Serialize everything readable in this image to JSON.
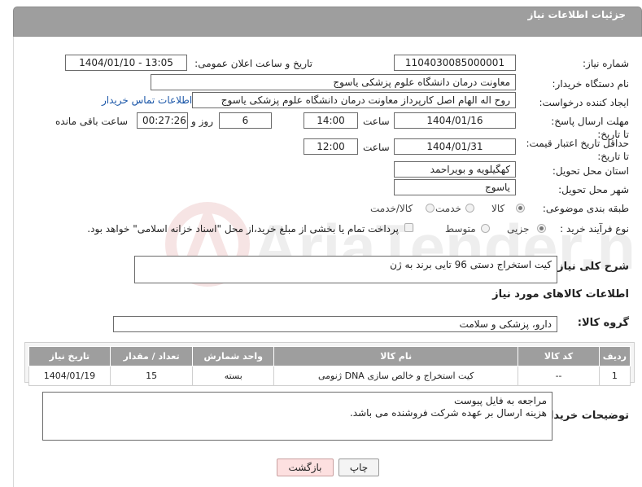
{
  "header": {
    "title": "جزئیات اطلاعات نیاز"
  },
  "fields": {
    "need_number": {
      "label": "شماره نیاز:",
      "value": "1104030085000001"
    },
    "announce_datetime": {
      "label": "تاریخ و ساعت اعلان عمومی:",
      "value": "1404/01/10 - 13:05"
    },
    "buyer_org": {
      "label": "نام دستگاه خریدار:",
      "value": "معاونت درمان دانشگاه علوم پزشکی یاسوج"
    },
    "requester": {
      "label": "ایجاد کننده درخواست:",
      "value": "روح اله الهام اصل کارپرداز معاونت درمان دانشگاه علوم پزشکی یاسوج",
      "contact_link": "اطلاعات تماس خریدار"
    },
    "reply_deadline": {
      "label": "مهلت ارسال پاسخ: تا تاریخ:",
      "date": "1404/01/16",
      "time_label": "ساعت",
      "time": "14:00",
      "days": "6",
      "days_label": "روز و",
      "remaining": "00:27:26",
      "remaining_label": "ساعت باقی مانده"
    },
    "price_validity": {
      "label": "حداقل تاریخ اعتبار قیمت: تا تاریخ:",
      "date": "1404/01/31",
      "time_label": "ساعت",
      "time": "12:00"
    },
    "delivery_province": {
      "label": "استان محل تحویل:",
      "value": "کهگیلویه و بویراحمد"
    },
    "delivery_city": {
      "label": "شهر محل تحویل:",
      "value": "یاسوج"
    },
    "category": {
      "label": "طبقه بندی موضوعی:",
      "options": [
        "کالا",
        "خدمت",
        "کالا/خدمت"
      ],
      "selected": "کالا"
    },
    "purchase_process": {
      "label": "نوع فرآیند خرید :",
      "options": [
        "جزیی",
        "متوسط"
      ],
      "selected": "جزیی",
      "note": "پرداخت تمام یا بخشی از مبلغ خرید،از محل \"اسناد خزانه اسلامی\" خواهد بود."
    },
    "summary": {
      "label": "شرح کلی نیاز:",
      "value": "کیت استخراج دستی 96 تایی برند به ژن"
    }
  },
  "goods_section": {
    "title": "اطلاعات کالاهای مورد نیاز",
    "group_label": "گروه کالا:",
    "group_value": "دارو، پزشکی و سلامت",
    "table": {
      "columns": [
        "ردیف",
        "کد کالا",
        "نام کالا",
        "واحد شمارش",
        "تعداد / مقدار",
        "تاریخ نیاز"
      ],
      "rows": [
        [
          "1",
          "--",
          "کیت استخراج و خالص سازی DNA ژنومی",
          "بسته",
          "15",
          "1404/01/19"
        ]
      ]
    }
  },
  "buyer_notes": {
    "label": "توضیحات خریدار:",
    "lines": [
      "مراجعه به فایل پیوست",
      "هزینه ارسال بر عهده شرکت فروشنده می باشد."
    ]
  },
  "buttons": {
    "print": "چاپ",
    "back": "بازگشت"
  },
  "watermark": {
    "text": "AriaTender.neT"
  },
  "colors": {
    "header_bg": "#9e9e9e",
    "link": "#1a56a8",
    "back_button_bg": "#fde0e0"
  }
}
